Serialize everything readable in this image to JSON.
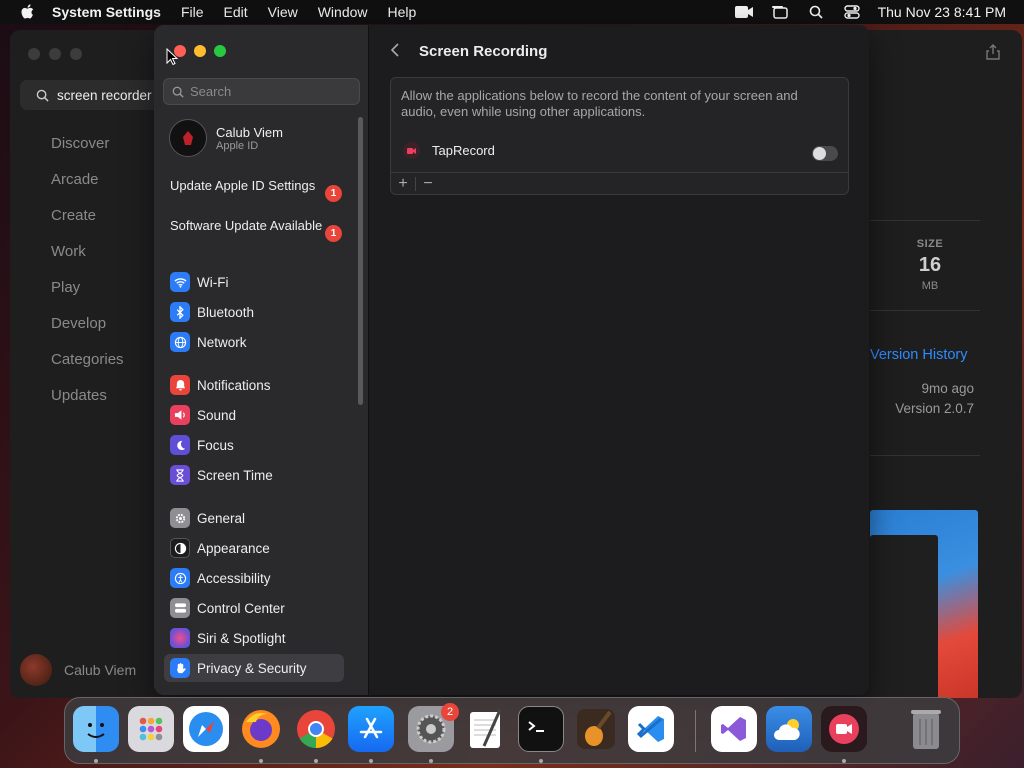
{
  "menubar": {
    "app_name": "System Settings",
    "menus": [
      "File",
      "Edit",
      "View",
      "Window",
      "Help"
    ],
    "datetime": "Thu Nov 23  8:41 PM"
  },
  "app_store": {
    "search_value": "screen recorder",
    "nav": [
      "Discover",
      "Arcade",
      "Create",
      "Work",
      "Play",
      "Develop",
      "Categories",
      "Updates"
    ],
    "user_name": "Calub Viem",
    "size_label": "SIZE",
    "size_value": "16",
    "size_unit": "MB",
    "version_history": "Version History",
    "updated_ago": "9mo ago",
    "version": "Version 2.0.7"
  },
  "settings": {
    "search_placeholder": "Search",
    "account": {
      "name": "Calub Viem",
      "sub": "Apple ID"
    },
    "updates": [
      {
        "label": "Update Apple ID Settings",
        "badge": "1"
      },
      {
        "label": "Software Update Available",
        "badge": "1"
      }
    ],
    "sidebar": [
      {
        "label": "Wi-Fi",
        "icon": "wifi-icon",
        "color": "#2b7cf6"
      },
      {
        "label": "Bluetooth",
        "icon": "bluetooth-icon",
        "color": "#2b7cf6"
      },
      {
        "label": "Network",
        "icon": "globe-icon",
        "color": "#2b7cf6"
      },
      {
        "label": "Notifications",
        "icon": "bell-icon",
        "color": "#e9453a"
      },
      {
        "label": "Sound",
        "icon": "speaker-icon",
        "color": "#e9405e"
      },
      {
        "label": "Focus",
        "icon": "moon-icon",
        "color": "#5e4fd6"
      },
      {
        "label": "Screen Time",
        "icon": "hourglass-icon",
        "color": "#6a4fd6"
      },
      {
        "label": "General",
        "icon": "gear-icon",
        "color": "#8e8e93"
      },
      {
        "label": "Appearance",
        "icon": "appearance-icon",
        "color": "#1c1c1e"
      },
      {
        "label": "Accessibility",
        "icon": "accessibility-icon",
        "color": "#2b7cf6"
      },
      {
        "label": "Control Center",
        "icon": "control-center-icon",
        "color": "#8e8e93"
      },
      {
        "label": "Siri & Spotlight",
        "icon": "siri-icon",
        "color": "#c04bd6"
      },
      {
        "label": "Privacy & Security",
        "icon": "hand-icon",
        "color": "#2b7cf6"
      }
    ],
    "page_title": "Screen Recording",
    "description": "Allow the applications below to record the content of your screen and audio, even while using other applications.",
    "apps": [
      {
        "name": "TapRecord",
        "enabled": false
      }
    ],
    "add_label": "+",
    "remove_label": "−"
  },
  "dock": {
    "badge_system_settings": "2"
  }
}
